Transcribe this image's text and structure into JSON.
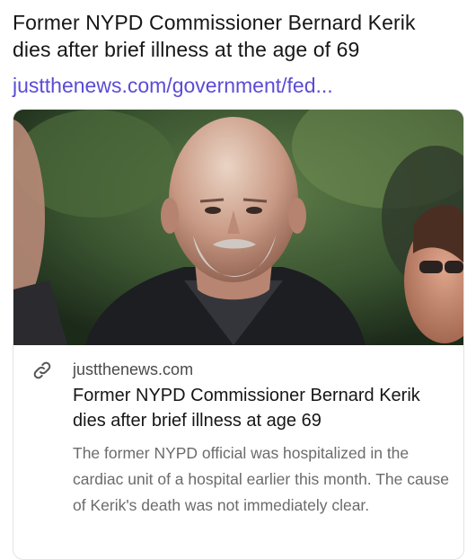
{
  "post": {
    "text": "Former NYPD Commissioner Bernard Kerik dies after brief illness at the age of 69",
    "link_text": "justthenews.com/government/fed..."
  },
  "link_card": {
    "image_icon": "photo",
    "link_icon": "link-icon",
    "domain": "justthenews.com",
    "title": "Former NYPD Commissioner Bernard Kerik dies after brief illness at age 69",
    "description": "The former NYPD official was hospitalized in the cardiac unit of a hospital earlier this month. The cause of Kerik's death was not immediately clear."
  },
  "colors": {
    "link": "#5b4bd6",
    "text": "#161616",
    "muted": "#6b6b6b",
    "card_border": "#e3e3e8"
  }
}
